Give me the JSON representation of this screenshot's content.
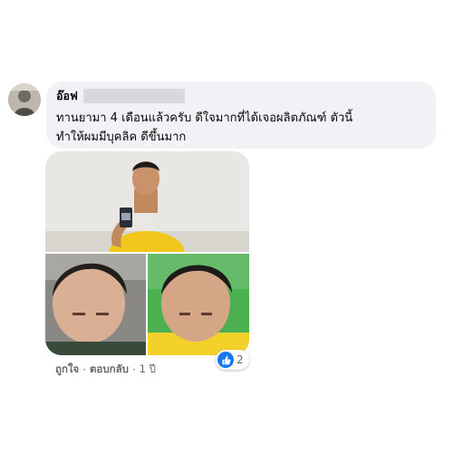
{
  "comment": {
    "author": "อ๊อฟ",
    "text_lines": [
      "ทานยามา 4 เดือนแล้วครับ  ดีใจมากที่ได้เจอผลิตภัณฑ์ ตัวนี้",
      "ทำให้ผมมีบุคลิค ดีขึ้นมาก"
    ],
    "actions": {
      "like": "ถูกใจ",
      "reply": "ตอบกลับ",
      "time": "1 ปี"
    },
    "reactions": {
      "icon": "thumbs-up-icon",
      "count": "2",
      "color": "#1877f2"
    }
  }
}
